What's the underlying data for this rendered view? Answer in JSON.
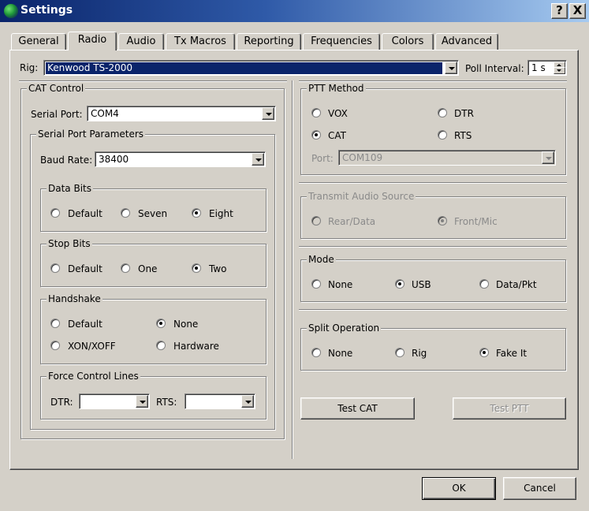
{
  "window": {
    "title": "Settings",
    "help_glyph": "?",
    "close_glyph": "X"
  },
  "tabs": [
    {
      "label": "General"
    },
    {
      "label": "Radio",
      "active": true
    },
    {
      "label": "Audio"
    },
    {
      "label": "Tx Macros"
    },
    {
      "label": "Reporting"
    },
    {
      "label": "Frequencies"
    },
    {
      "label": "Colors"
    },
    {
      "label": "Advanced"
    }
  ],
  "rig": {
    "label": "Rig:",
    "value": "Kenwood TS-2000",
    "poll_label": "Poll Interval:",
    "poll_value": "1 s"
  },
  "cat_control": {
    "title": "CAT Control",
    "serial_port_label": "Serial Port:",
    "serial_port_value": "COM4",
    "params_title": "Serial Port Parameters",
    "baud_label": "Baud Rate:",
    "baud_value": "38400",
    "data_bits": {
      "title": "Data Bits",
      "options": [
        "Default",
        "Seven",
        "Eight"
      ],
      "selected": "Eight"
    },
    "stop_bits": {
      "title": "Stop Bits",
      "options": [
        "Default",
        "One",
        "Two"
      ],
      "selected": "Two"
    },
    "handshake": {
      "title": "Handshake",
      "options": [
        "Default",
        "None",
        "XON/XOFF",
        "Hardware"
      ],
      "selected": "None"
    },
    "force_lines": {
      "title": "Force Control Lines",
      "dtr_label": "DTR:",
      "dtr_value": "",
      "rts_label": "RTS:",
      "rts_value": ""
    }
  },
  "ptt": {
    "title": "PTT Method",
    "options": [
      "VOX",
      "DTR",
      "CAT",
      "RTS"
    ],
    "selected": "CAT",
    "port_label": "Port:",
    "port_value": "COM109"
  },
  "tx_audio": {
    "title": "Transmit Audio Source",
    "options": [
      "Rear/Data",
      "Front/Mic"
    ],
    "selected": "Front/Mic"
  },
  "mode": {
    "title": "Mode",
    "options": [
      "None",
      "USB",
      "Data/Pkt"
    ],
    "selected": "USB"
  },
  "split": {
    "title": "Split Operation",
    "options": [
      "None",
      "Rig",
      "Fake It"
    ],
    "selected": "Fake It"
  },
  "buttons": {
    "test_cat": "Test CAT",
    "test_ptt": "Test PTT",
    "ok": "OK",
    "cancel": "Cancel"
  }
}
